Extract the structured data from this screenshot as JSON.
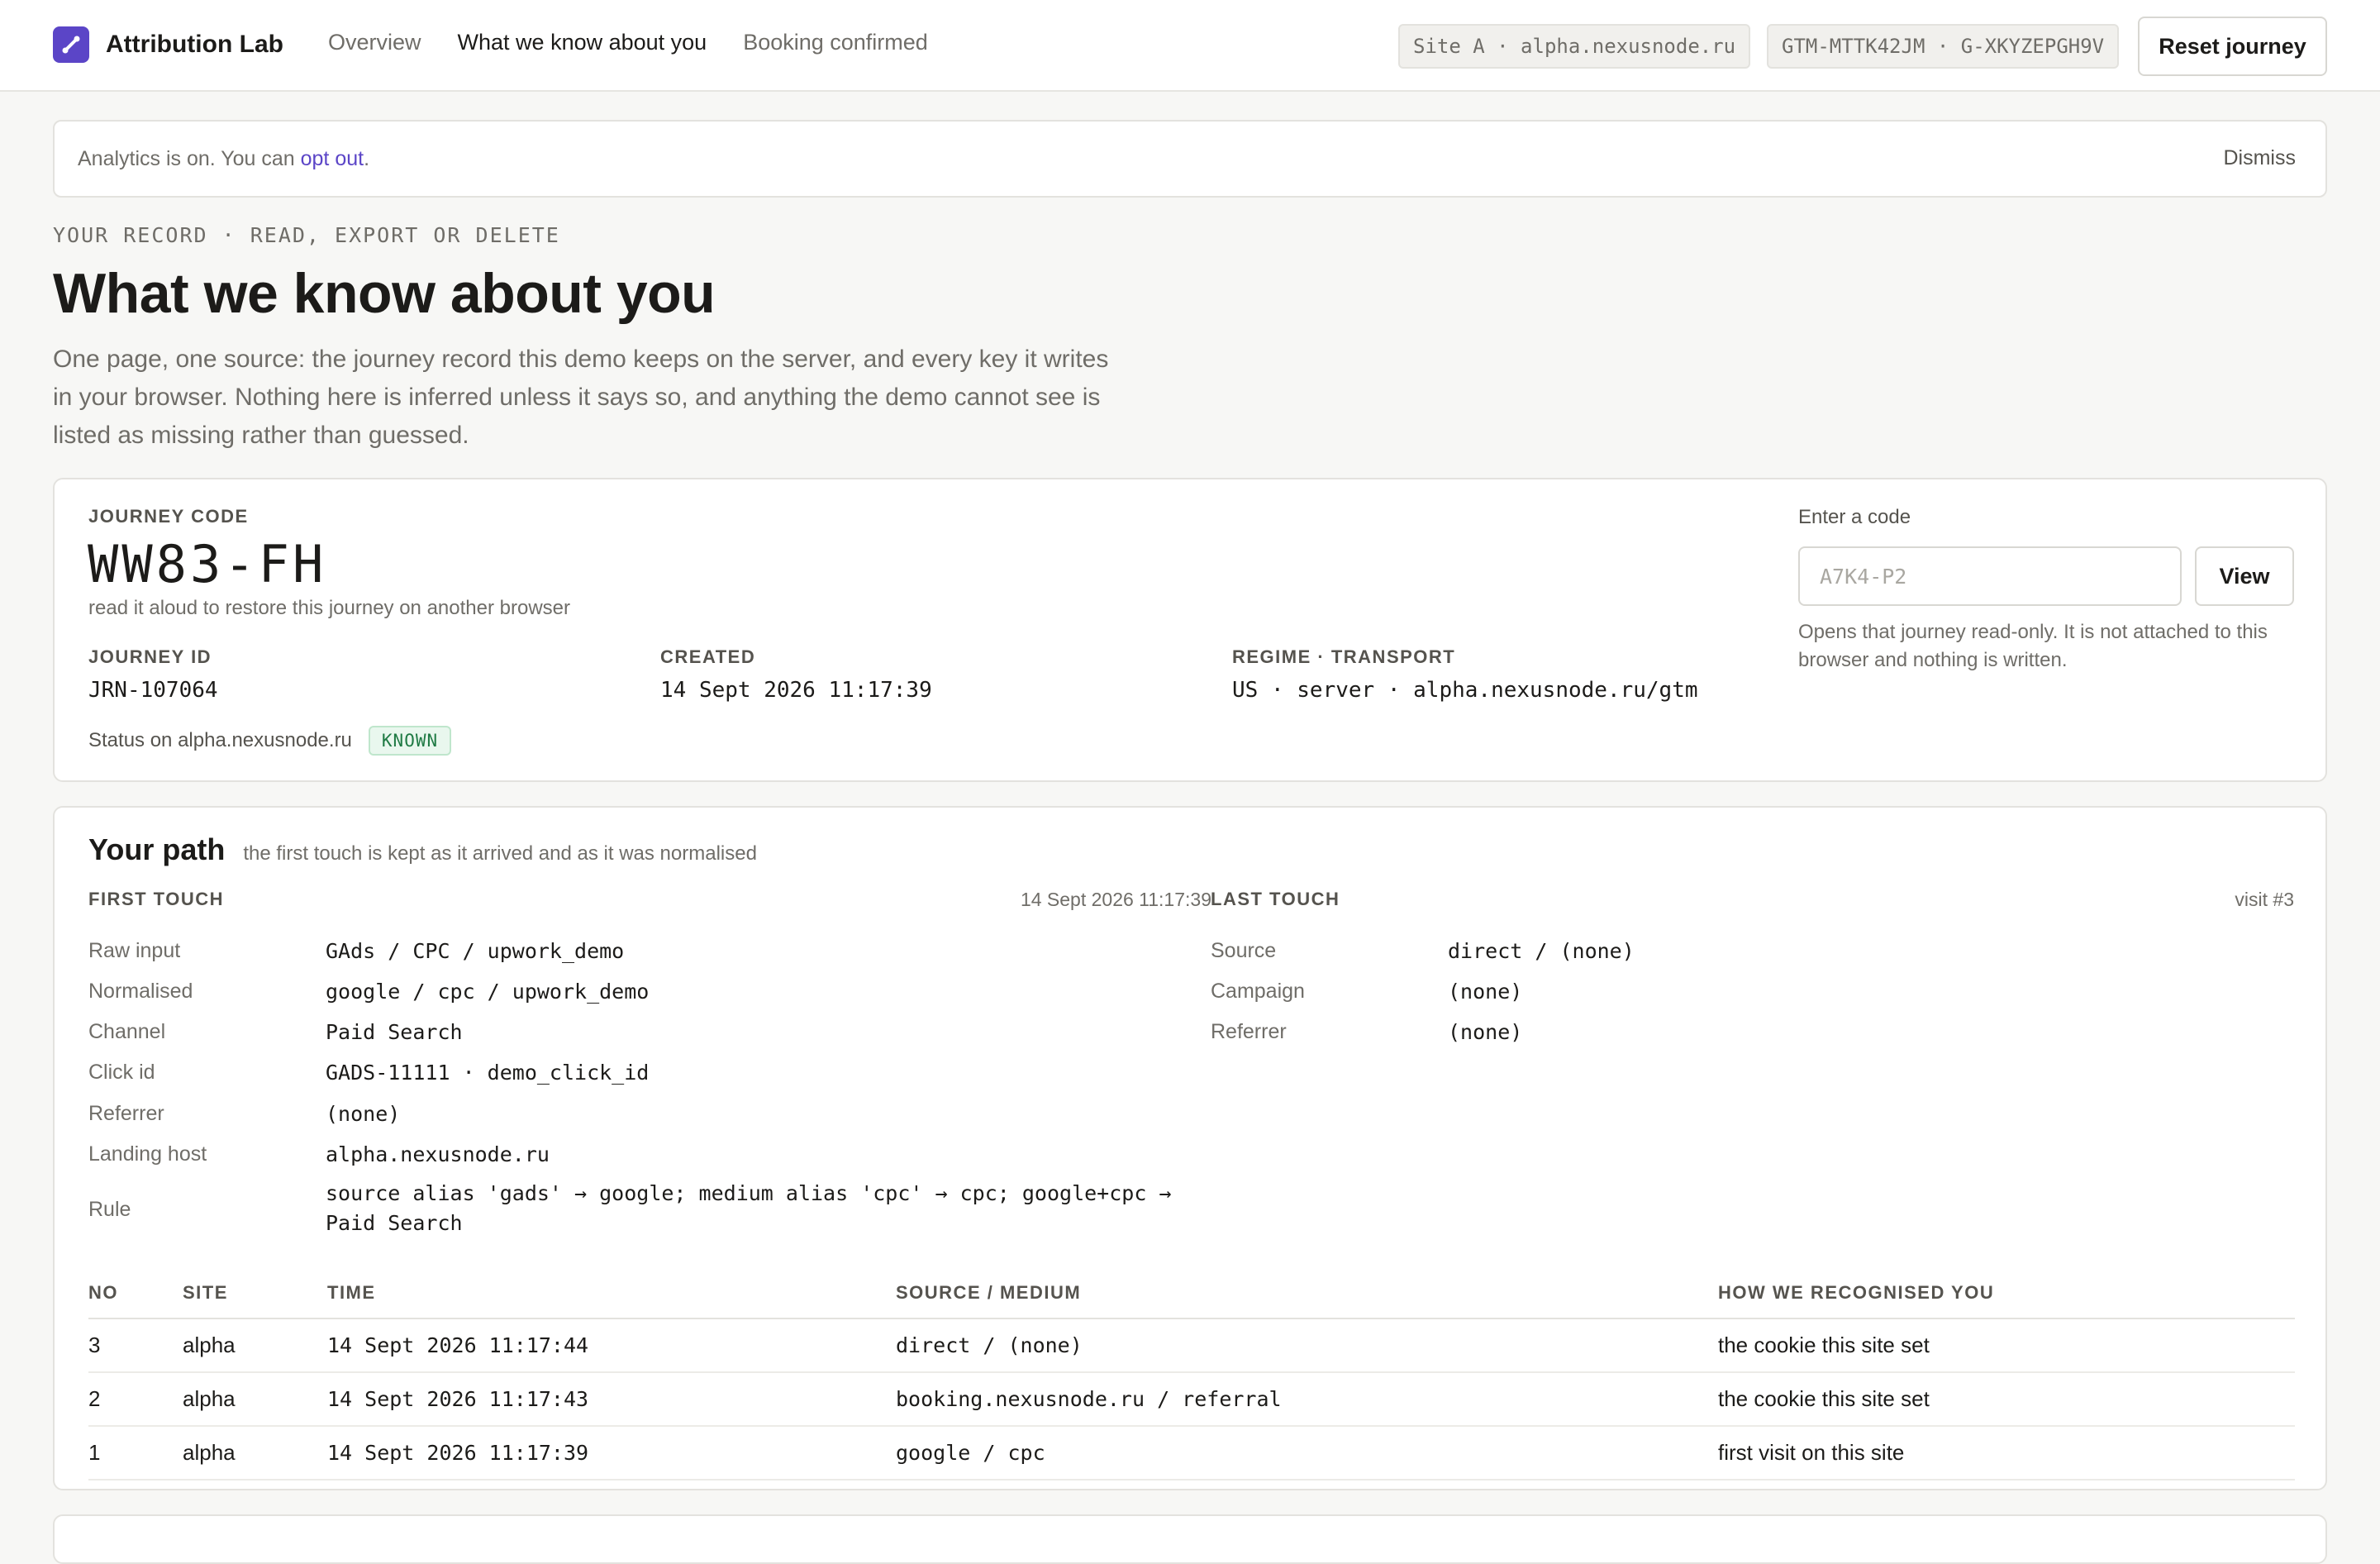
{
  "header": {
    "brand": "Attribution Lab",
    "nav": [
      {
        "label": "Overview",
        "active": false
      },
      {
        "label": "What we know about you",
        "active": true
      },
      {
        "label": "Booking confirmed",
        "active": false
      }
    ],
    "site_pill": "Site A · alpha.nexusnode.ru",
    "tag_pill": "GTM-MTTK42JM · G-XKYZEPGH9V",
    "reset_label": "Reset journey"
  },
  "banner": {
    "text_before": "Analytics is on. You can ",
    "link": "opt out",
    "text_after": ".",
    "dismiss": "Dismiss"
  },
  "page": {
    "eyebrow": "YOUR RECORD · READ, EXPORT OR DELETE",
    "title": "What we know about you",
    "lede": "One page, one source: the journey record this demo keeps on the server, and every key it writes in your browser. Nothing here is inferred unless it says so, and anything the demo cannot see is listed as missing rather than guessed."
  },
  "journey": {
    "code_label": "JOURNEY CODE",
    "code": "WW83-FH",
    "code_hint": "read it aloud to restore this journey on another browser",
    "id_label": "JOURNEY ID",
    "id": "JRN-107064",
    "created_label": "CREATED",
    "created": "14 Sept 2026 11:17:39",
    "regime_label": "REGIME · TRANSPORT",
    "regime": "US · server · alpha.nexusnode.ru/gtm",
    "status_label": "Status on alpha.nexusnode.ru",
    "status": "KNOWN",
    "enter_label": "Enter a code",
    "enter_placeholder": "A7K4-P2",
    "view_label": "View",
    "enter_note": "Opens that journey read-only. It is not attached to this browser and nothing is written."
  },
  "path": {
    "title": "Your path",
    "subtitle": "the first touch is kept as it arrived and as it was normalised",
    "first": {
      "label": "FIRST TOUCH",
      "time": "14 Sept 2026 11:17:39",
      "rows": [
        {
          "k": "Raw input",
          "v": "GAds / CPC / upwork_demo"
        },
        {
          "k": "Normalised",
          "v": "google / cpc / upwork_demo"
        },
        {
          "k": "Channel",
          "v": "Paid Search"
        },
        {
          "k": "Click id",
          "v": "GADS-11111 · demo_click_id"
        },
        {
          "k": "Referrer",
          "v": "(none)"
        },
        {
          "k": "Landing host",
          "v": "alpha.nexusnode.ru"
        }
      ],
      "rule_key": "Rule",
      "rule_line1": "source alias 'gads' → google; medium alias 'cpc' → cpc; google+cpc →",
      "rule_line2": "Paid Search"
    },
    "last": {
      "label": "LAST TOUCH",
      "visit": "visit #3",
      "rows": [
        {
          "k": "Source",
          "v": "direct / (none)"
        },
        {
          "k": "Campaign",
          "v": "(none)"
        },
        {
          "k": "Referrer",
          "v": "(none)"
        }
      ]
    },
    "table": {
      "headers": [
        "NO",
        "SITE",
        "TIME",
        "SOURCE / MEDIUM",
        "HOW WE RECOGNISED YOU"
      ],
      "rows": [
        [
          "3",
          "alpha",
          "14 Sept 2026 11:17:44",
          "direct / (none)",
          "the cookie this site set"
        ],
        [
          "2",
          "alpha",
          "14 Sept 2026 11:17:43",
          "booking.nexusnode.ru / referral",
          "the cookie this site set"
        ],
        [
          "1",
          "alpha",
          "14 Sept 2026 11:17:39",
          "google / cpc",
          "first visit on this site"
        ]
      ]
    }
  },
  "colors": {
    "accent": "#5b45c7",
    "badge_green": "#1f7a44",
    "text": "#1c1b19",
    "muted": "#6f6d68"
  }
}
